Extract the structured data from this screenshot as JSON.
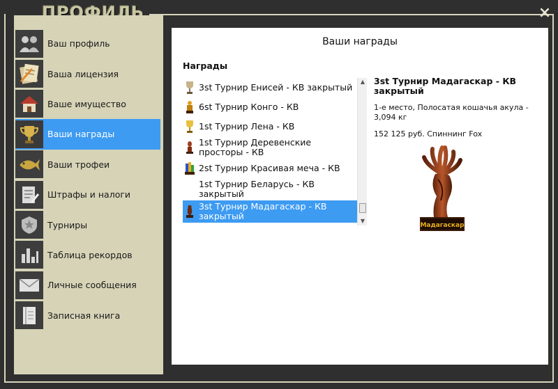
{
  "window": {
    "title": "ПРОФИЛЬ",
    "close_label": "×"
  },
  "sidebar": {
    "items": [
      {
        "label": "Ваш профиль",
        "icon": "users-icon",
        "active": false
      },
      {
        "label": "Ваша лицензия",
        "icon": "license-icon",
        "active": false
      },
      {
        "label": "Ваше имущество",
        "icon": "house-icon",
        "active": false
      },
      {
        "label": "Ваши награды",
        "icon": "trophy-icon",
        "active": true
      },
      {
        "label": "Ваши трофеи",
        "icon": "fish-icon",
        "active": false
      },
      {
        "label": "Штрафы и налоги",
        "icon": "fines-icon",
        "active": false
      },
      {
        "label": "Турниры",
        "icon": "tournament-icon",
        "active": false
      },
      {
        "label": "Таблица рекордов",
        "icon": "records-icon",
        "active": false
      },
      {
        "label": "Личные сообщения",
        "icon": "envelope-icon",
        "active": false
      },
      {
        "label": "Записная книга",
        "icon": "notebook-icon",
        "active": false
      }
    ]
  },
  "main": {
    "title": "Ваши награды",
    "list_heading": "Награды",
    "awards": [
      {
        "text": "3st Турнир Енисей - КВ закрытый",
        "trophy": "silver",
        "selected": false
      },
      {
        "text": "6st Турнир Конго - КВ",
        "trophy": "gold",
        "selected": false
      },
      {
        "text": "1st Турнир Лена - КВ",
        "trophy": "gold-cup",
        "selected": false
      },
      {
        "text": "1st Турнир Деревенские просторы - КВ",
        "trophy": "bronze",
        "selected": false
      },
      {
        "text": "2st Турнир Красивая меча - КВ",
        "trophy": "multi",
        "selected": false
      },
      {
        "text": "1st Турнир Беларусь - КВ закрытый",
        "trophy": "none",
        "selected": false
      },
      {
        "text": "3st Турнир Мадагаскар - КВ закрытый",
        "trophy": "wooden",
        "selected": true
      }
    ],
    "detail": {
      "title": "3st Турнир Мадагаскар - КВ закрытый",
      "description": "1-е место, Полосатая кошачья акула - 3,094 кг",
      "prize": "152 125 руб. Спиннинг Fox",
      "plaque": "Мадагаскар"
    }
  },
  "colors": {
    "accent": "#3d9bf2",
    "frame": "#2f2f2f",
    "sidebar_bg": "#d6d3b7"
  }
}
